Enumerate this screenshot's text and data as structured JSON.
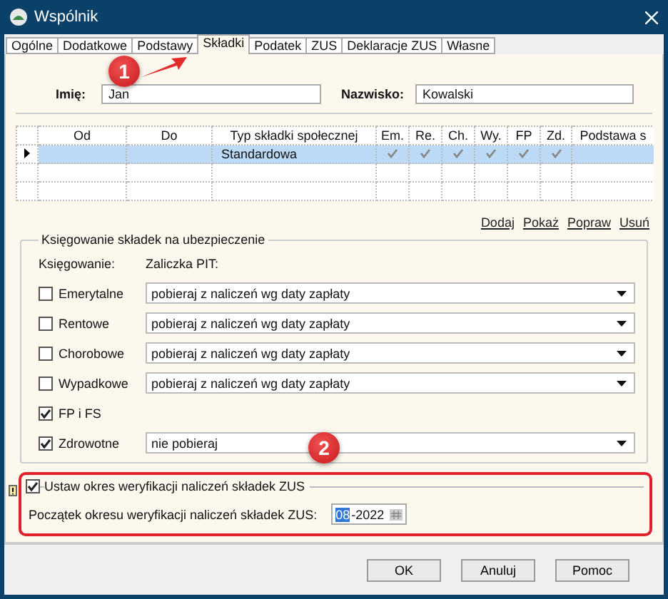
{
  "window": {
    "title": "Wspólnik"
  },
  "tabs": [
    {
      "label": "Ogólne",
      "selected": false
    },
    {
      "label": "Dodatkowe",
      "selected": false
    },
    {
      "label": "Podstawy",
      "selected": false
    },
    {
      "label": "Składki",
      "selected": true
    },
    {
      "label": "Podatek",
      "selected": false
    },
    {
      "label": "ZUS",
      "selected": false
    },
    {
      "label": "Deklaracje ZUS",
      "selected": false
    },
    {
      "label": "Własne",
      "selected": false
    }
  ],
  "name": {
    "first_label": "Imię:",
    "first_value": "Jan",
    "last_label": "Nazwisko:",
    "last_value": "Kowalski"
  },
  "table": {
    "columns": [
      "Od",
      "Do",
      "Typ składki społecznej",
      "Em.",
      "Re.",
      "Ch.",
      "Wy.",
      "FP",
      "Zd.",
      "Podstawa s"
    ],
    "rows": [
      {
        "selected": true,
        "od": "",
        "do": "",
        "typ": "Standardowa",
        "checks": [
          true,
          true,
          true,
          true,
          true,
          true
        ]
      }
    ]
  },
  "links": [
    "Dodaj",
    "Pokaż",
    "Popraw",
    "Usuń"
  ],
  "booking": {
    "title": "Księgowanie składek na ubezpieczenie",
    "col_label": "Księgowanie:",
    "pit_label": "Zaliczka PIT:",
    "items": [
      {
        "label": "Emerytalne",
        "checked": false,
        "value": "pobieraj z naliczeń wg daty zapłaty"
      },
      {
        "label": "Rentowe",
        "checked": false,
        "value": "pobieraj z naliczeń wg daty zapłaty"
      },
      {
        "label": "Chorobowe",
        "checked": false,
        "value": "pobieraj z naliczeń wg daty zapłaty"
      },
      {
        "label": "Wypadkowe",
        "checked": false,
        "value": "pobieraj z naliczeń wg daty zapłaty"
      },
      {
        "label": "FP i FS",
        "checked": true
      },
      {
        "label": "Zdrowotne",
        "checked": true,
        "value": "nie pobieraj"
      }
    ]
  },
  "verification": {
    "label": "Ustaw okres weryfikacji naliczeń składek ZUS",
    "checked": true,
    "start_label": "Początek okresu weryfikacji naliczeń składek ZUS:",
    "month": "08",
    "year": "-2022"
  },
  "annotations": [
    "1",
    "2"
  ],
  "buttons": [
    "OK",
    "Anuluj",
    "Pomoc"
  ]
}
